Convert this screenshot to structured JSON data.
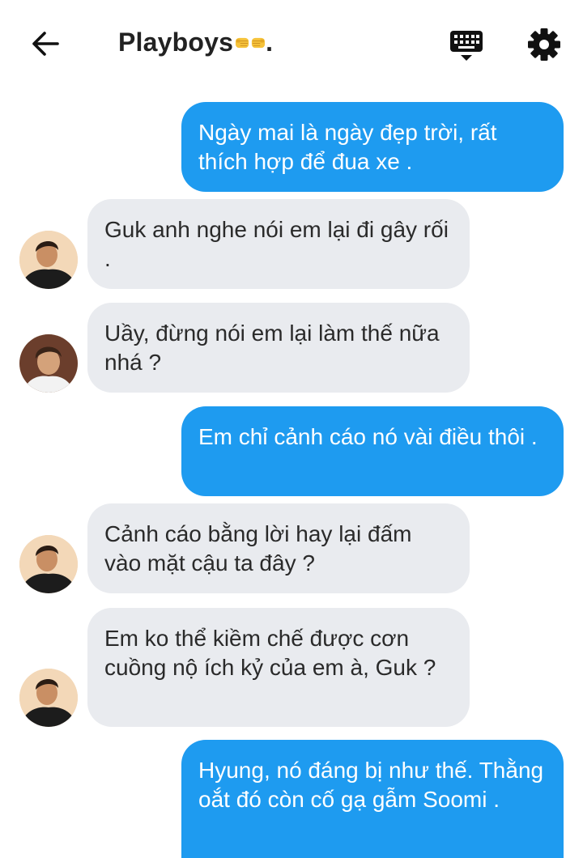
{
  "header": {
    "title": "Playboys",
    "title_suffix": ".",
    "icons": [
      "arrow-left-icon",
      "fist-bump-emoji",
      "keyboard-icon",
      "gear-icon"
    ]
  },
  "colors": {
    "outgoing": "#1e9bf0",
    "incoming": "#e9ebef",
    "header_text": "#222222"
  },
  "messages": [
    {
      "side": "out",
      "text": "Ngày mai là ngày đẹp trời, rất thích hợp để đua xe ."
    },
    {
      "side": "in",
      "avatar": "avatar-guy-smiling",
      "text": "Guk anh nghe nói em lại đi gây rối ."
    },
    {
      "side": "in",
      "avatar": "avatar-guy-white-shirt",
      "text": "Uầy, đừng nói em lại làm thế nữa nhá ?"
    },
    {
      "side": "out",
      "text": "Em chỉ cảnh cáo nó vài điều thôi ."
    },
    {
      "side": "in",
      "avatar": "avatar-guy-smiling",
      "text": "Cảnh cáo bằng lời hay lại đấm vào mặt cậu ta đây ?"
    },
    {
      "side": "in",
      "avatar": "avatar-guy-smiling",
      "text": "Em ko thể kiềm chế được cơn cuồng nộ ích kỷ của em à, Guk ?"
    },
    {
      "side": "out",
      "text": "Hyung, nó đáng bị như thế. Thằng oắt đó còn cố gạ gẫm Soomi ."
    }
  ]
}
